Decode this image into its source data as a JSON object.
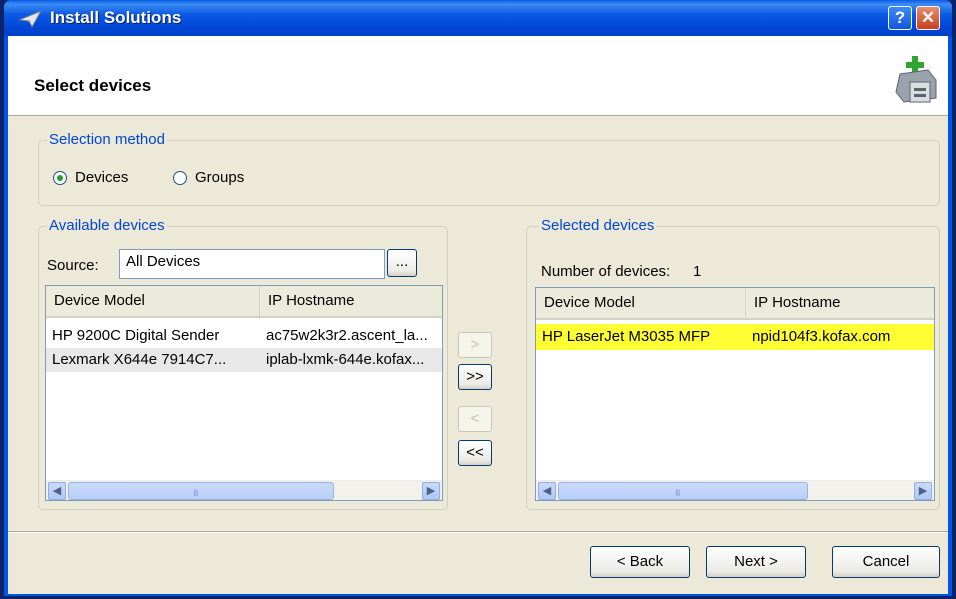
{
  "window": {
    "title": "Install Solutions",
    "help_symbol": "?",
    "close_symbol": "✕"
  },
  "header": {
    "title": "Select devices",
    "icon": "printer-add-icon"
  },
  "selection_method": {
    "label": "Selection method",
    "options": [
      {
        "label": "Devices",
        "selected": true
      },
      {
        "label": "Groups",
        "selected": false
      }
    ]
  },
  "available": {
    "label": "Available devices",
    "source_label": "Source:",
    "source_value": "All Devices",
    "browse_label": "...",
    "columns": [
      "Device Model",
      "IP Hostname"
    ],
    "rows": [
      {
        "model": "HP 9200C Digital Sender",
        "host": "ac75w2k3r2.ascent_la..."
      },
      {
        "model": "Lexmark X644e 7914C7...",
        "host": "iplab-lxmk-644e.kofax..."
      }
    ],
    "scroll_grip": "III"
  },
  "transfer": {
    "add": ">",
    "add_all": ">>",
    "remove": "<",
    "remove_all": "<<"
  },
  "selected": {
    "label": "Selected devices",
    "count_label": "Number of devices:",
    "count": "1",
    "columns": [
      "Device Model",
      "IP Hostname"
    ],
    "rows": [
      {
        "model": "HP LaserJet M3035 MFP",
        "host": "npid104f3.kofax.com"
      }
    ],
    "scroll_grip": "III"
  },
  "footer": {
    "back": "< Back",
    "next": "Next >",
    "cancel": "Cancel"
  },
  "colors": {
    "titlebar": "#0055e5",
    "dialog_bg": "#ece9d8",
    "group_title": "#0046d5",
    "highlight_row": "#ffff33"
  }
}
